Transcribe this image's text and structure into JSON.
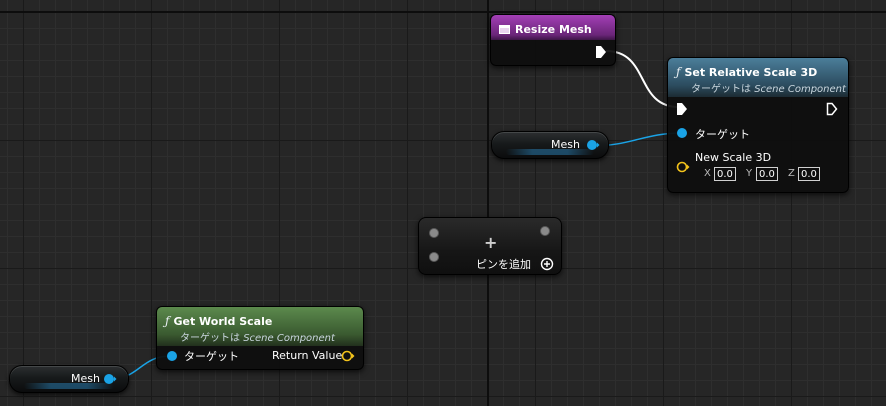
{
  "nodes": {
    "resize_mesh": {
      "title": "Resize Mesh"
    },
    "set_relative_scale": {
      "title": "Set Relative Scale 3D",
      "subtitle_prefix": "ターゲットは",
      "subtitle_class": "Scene Component",
      "target_pin": "ターゲット",
      "new_scale_pin": "New Scale 3D",
      "scale": {
        "x_label": "X",
        "x": "0.0",
        "y_label": "Y",
        "y": "0.0",
        "z_label": "Z",
        "z": "0.0"
      }
    },
    "mesh_var_top": {
      "label": "Mesh"
    },
    "mesh_var_bottom": {
      "label": "Mesh"
    },
    "sequence": {
      "add_pin_label": "ピンを追加"
    },
    "get_world_scale": {
      "title": "Get World Scale",
      "subtitle_prefix": "ターゲットは",
      "subtitle_class": "Scene Component",
      "target_pin": "ターゲット",
      "return_pin": "Return Value"
    }
  },
  "colors": {
    "object_pin": "#1aa3e6",
    "vector_pin": "#f2c21b",
    "exec_pin": "#ffffff",
    "function_header": "#4b7e9a",
    "pure_function_header": "#5c8a4d",
    "event_header": "#a33fb6"
  },
  "icons": [
    "function-icon",
    "event-icon",
    "exec-pin-icon",
    "object-pin-icon",
    "vector-pin-icon",
    "add-circle-icon",
    "plus-icon"
  ]
}
